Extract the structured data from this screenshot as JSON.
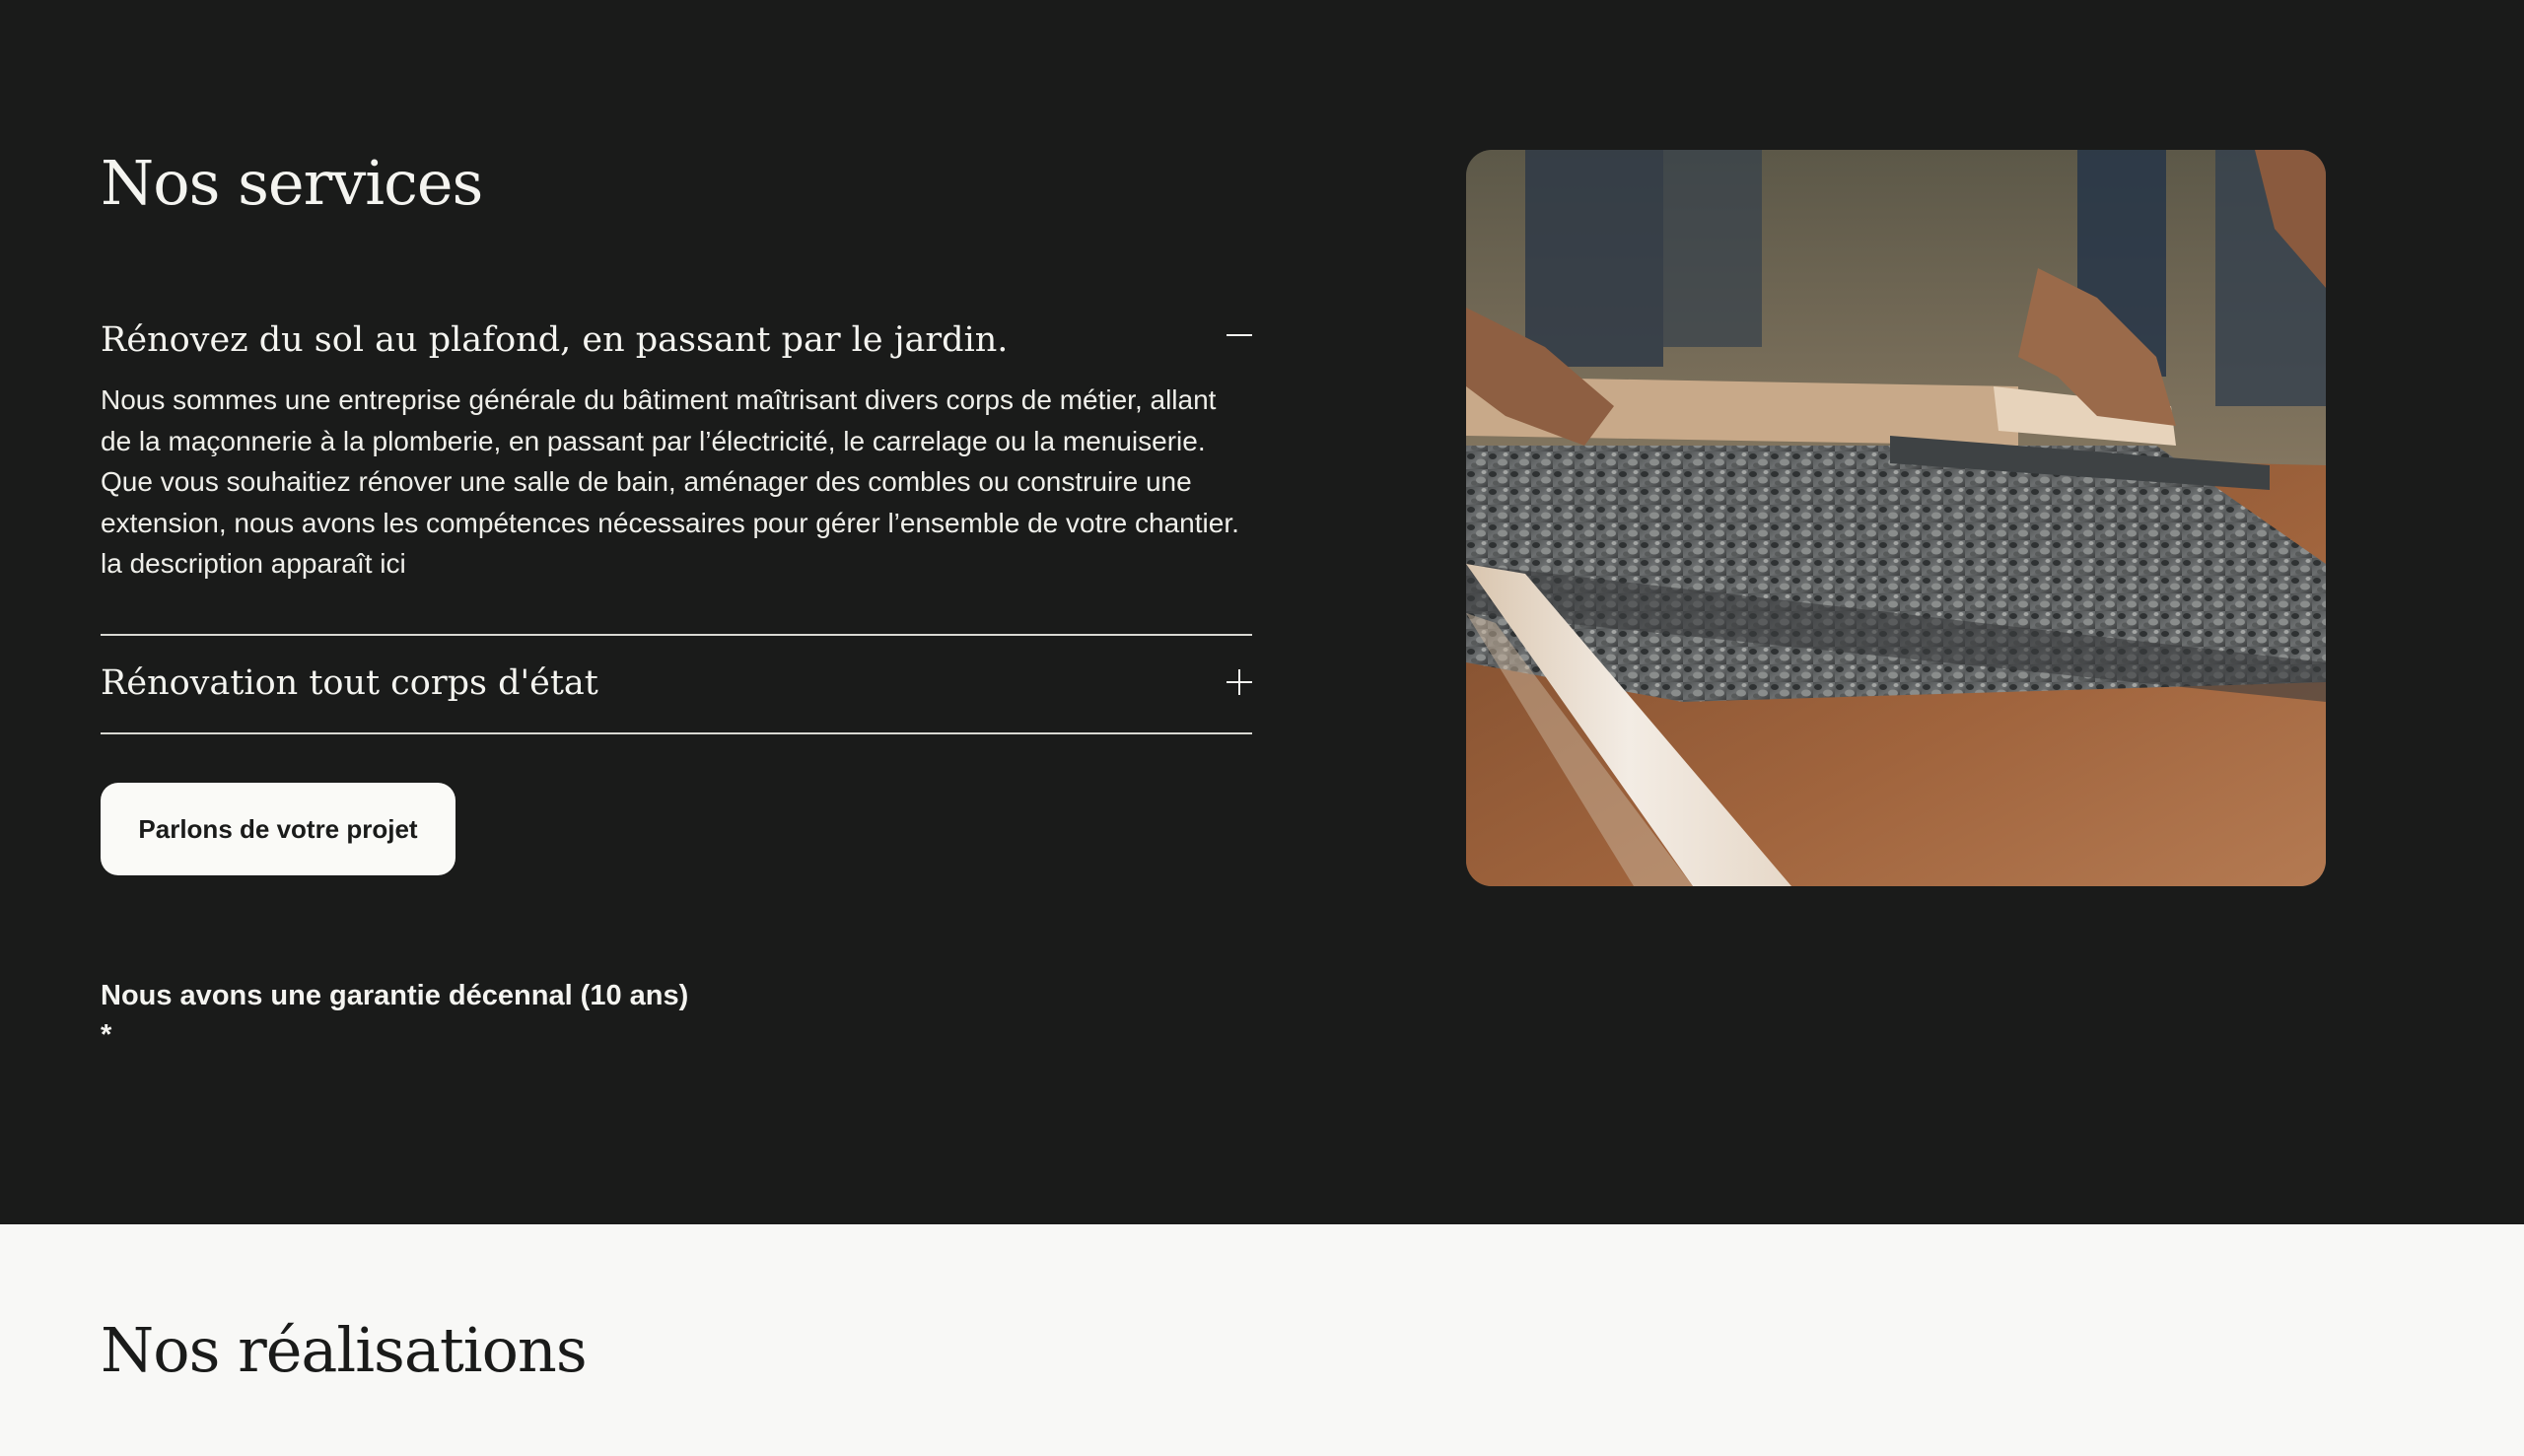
{
  "services": {
    "title": "Nos services",
    "accordion": [
      {
        "title": "Rénovez du sol au plafond, en passant par le jardin.",
        "expanded": true,
        "icon": "minus-icon",
        "body": "Nous sommes une entreprise générale du bâtiment maîtrisant divers corps de métier, allant de la maçonnerie à la plomberie, en passant par l’électricité, le carrelage ou la menuiserie. Que vous souhaitiez rénover une salle de bain, aménager des combles ou construire une extension, nous avons les compétences nécessaires pour gérer l’ensemble de votre chantier. la description apparaît ici"
      },
      {
        "title": "Rénovation tout corps d'état",
        "expanded": false,
        "icon": "plus-icon"
      }
    ],
    "cta_label": "Parlons de votre projet",
    "guarantee": "Nous avons une garantie décennal (10 ans)",
    "guarantee_mark": "*"
  },
  "realisations": {
    "title": "Nos réalisations"
  },
  "colors": {
    "dark_bg": "#1a1b1a",
    "light_bg": "#f8f8f6",
    "text_light": "#f4f4f0",
    "text_dark": "#1a1b1a"
  }
}
